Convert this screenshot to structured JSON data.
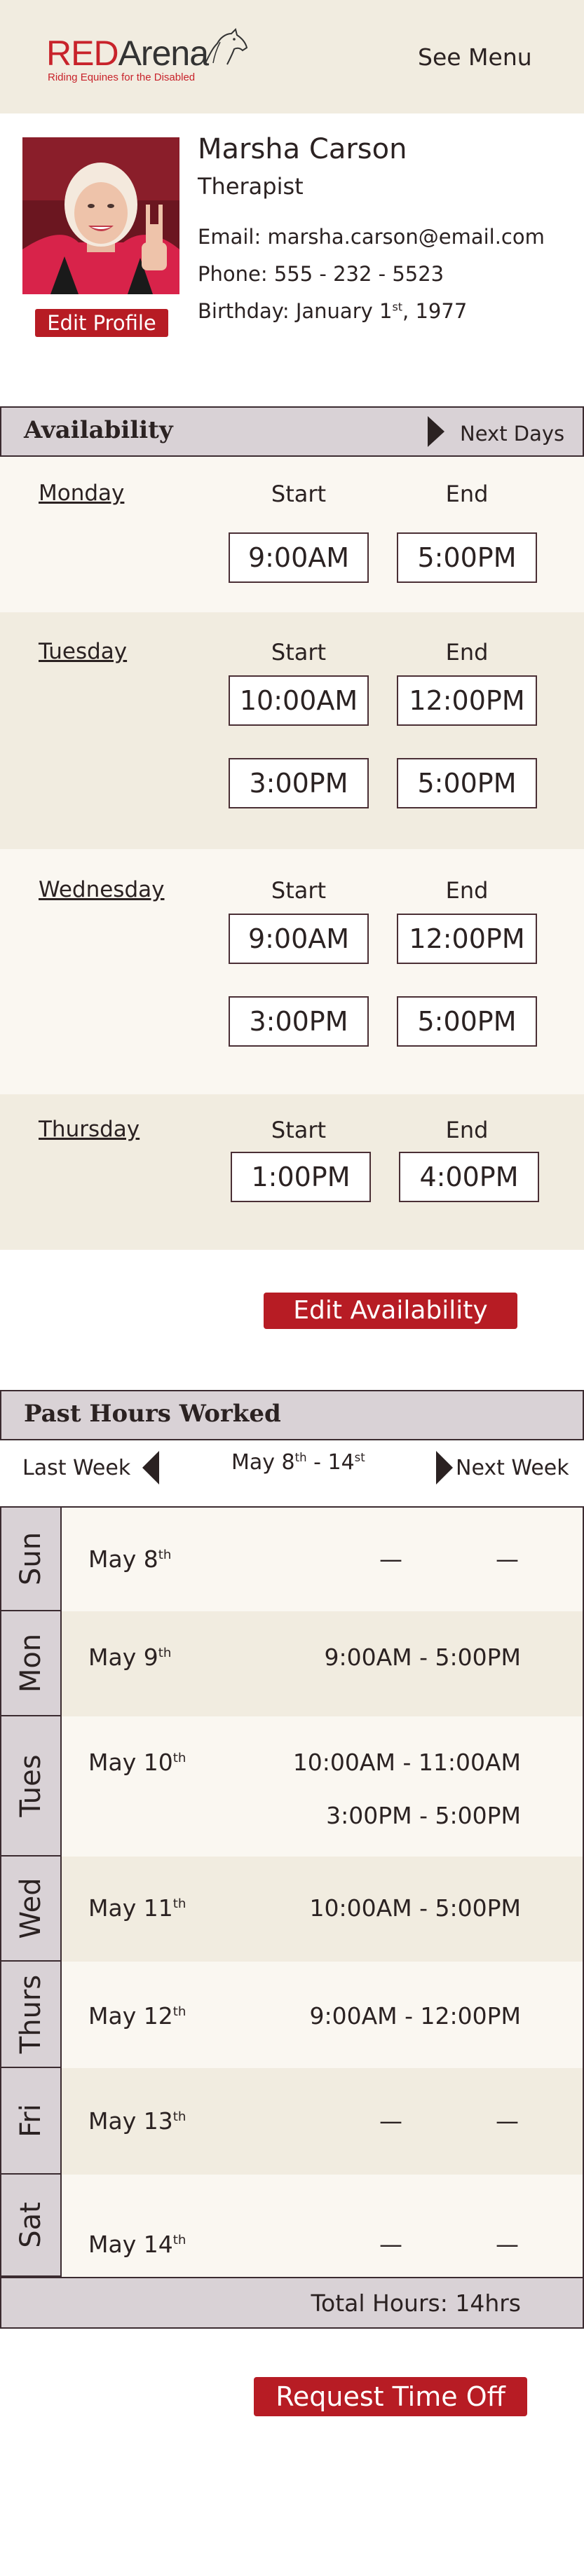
{
  "header": {
    "logo_red": "RED",
    "logo_dark": "Arena",
    "logo_sub": "Riding Equines for the Disabled",
    "menu_label": "See Menu"
  },
  "profile": {
    "name": "Marsha Carson",
    "role": "Therapist",
    "email_line": "Email: marsha.carson@email.com",
    "phone_line": "Phone: 555 - 232 - 5523",
    "birthday_prefix": "Birthday: January 1",
    "birthday_sup": "st",
    "birthday_suffix": ", 1977",
    "edit_label": "Edit Profile"
  },
  "availability": {
    "title": "Availability",
    "next_label": "Next Days",
    "start_label": "Start",
    "end_label": "End",
    "days": [
      {
        "name": "Monday",
        "slots": [
          {
            "start": "9:00AM",
            "end": "5:00PM"
          }
        ]
      },
      {
        "name": "Tuesday",
        "slots": [
          {
            "start": "10:00AM",
            "end": "12:00PM"
          },
          {
            "start": "3:00PM",
            "end": "5:00PM"
          }
        ]
      },
      {
        "name": "Wednesday",
        "slots": [
          {
            "start": "9:00AM",
            "end": "12:00PM"
          },
          {
            "start": "3:00PM",
            "end": "5:00PM"
          }
        ]
      },
      {
        "name": "Thursday",
        "slots": [
          {
            "start": "1:00PM",
            "end": "4:00PM"
          }
        ]
      }
    ],
    "edit_label": "Edit Availability"
  },
  "hours": {
    "title": "Past Hours Worked",
    "prev_label": "Last Week",
    "next_label": "Next Week",
    "range_a": "May 8",
    "range_a_sup": "th",
    "range_mid": " - 14",
    "range_b_sup": "st",
    "dash": "—",
    "rows": [
      {
        "day": "Sun",
        "date": "May 8",
        "sup": "th",
        "ranges": []
      },
      {
        "day": "Mon",
        "date": "May 9",
        "sup": "th",
        "ranges": [
          "9:00AM - 5:00PM"
        ]
      },
      {
        "day": "Tues",
        "date": "May 10",
        "sup": "th",
        "ranges": [
          "10:00AM - 11:00AM",
          "3:00PM - 5:00PM"
        ]
      },
      {
        "day": "Wed",
        "date": "May 11",
        "sup": "th",
        "ranges": [
          "10:00AM - 5:00PM"
        ]
      },
      {
        "day": "Thurs",
        "date": "May 12",
        "sup": "th",
        "ranges": [
          "9:00AM - 12:00PM"
        ]
      },
      {
        "day": "Fri",
        "date": "May 13",
        "sup": "th",
        "ranges": []
      },
      {
        "day": "Sat",
        "date": "May 14",
        "sup": "th",
        "ranges": []
      }
    ],
    "total_label": "Total Hours: 14hrs"
  },
  "request_label": "Request Time Off",
  "colors": {
    "header_bg": "#f1ece0",
    "row_light": "#faf7f1",
    "row_dark": "#f1ece0",
    "accent_red": "#b71c24",
    "bar_gray": "#d9d2d6"
  }
}
